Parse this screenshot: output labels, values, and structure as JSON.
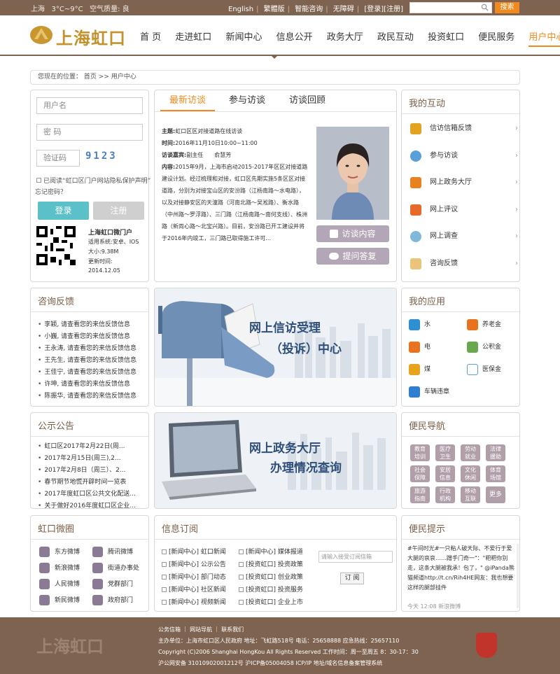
{
  "topbar": {
    "city": "上海",
    "temp": "3°C~9°C",
    "air": "空气质量: 良",
    "links": [
      "English",
      "繁體版",
      "智能咨询",
      "无障碍"
    ],
    "auth": "[登录][注册]",
    "search_button": "搜索"
  },
  "header": {
    "logo_text": "上海虹口",
    "nav": [
      "首 页",
      "走进虹口",
      "新闻中心",
      "信息公开",
      "政务大厅",
      "政民互动",
      "投资虹口",
      "便民服务",
      "用户中心"
    ],
    "active_nav": "用户中心"
  },
  "breadcrumb": {
    "label": "您现在的位置：",
    "home": "首页",
    "sep": ">>",
    "current": "用户中心"
  },
  "login": {
    "username_placeholder": "用户名",
    "password_placeholder": "密  码",
    "captcha_placeholder": "验证码",
    "captcha_code": "9123",
    "privacy": "已阅读“虹口区门户网站隐私保护声明”",
    "forgot": "忘记密码？",
    "login_button": "登录",
    "register_button": "注册",
    "app_title": "上海虹口微门户",
    "app_system": "适用系统:安卓、IOS",
    "app_size": "大小:9.38M",
    "app_updated_label": "更新时间:",
    "app_updated": "2014.12.05"
  },
  "interview": {
    "tabs": [
      "最新访谈",
      "参与访谈",
      "访谈回顾"
    ],
    "topic_label": "主题:",
    "topic": "虹口区区对接道路在线访谈",
    "time_label": "时间:",
    "time": "2016年11月10日10:00~11:00",
    "guest_label": "访谈嘉宾:",
    "guest": "副主任　　俞慧芳",
    "content_label": "内容:",
    "content": "2015年9月，上海市启动2015-2017年区区对接道路建设计划。经过梳理和对接，虹口区先期实施5条区区对接道路，分别为对接宝山区的安汾路（江杨南路～水电路），以及对接静安区的天潼路（河南北路～吴淞路）、衡水路（中州路～罗浮路）、三门路（江杨南路～南何支线）、株洲路（新両心路～北宝兴路）。目前，安汾路已开工建设并将于2016年内竣工，三门路已取得施工许可...",
    "btn_content": "访谈内容",
    "btn_question": "提问答复"
  },
  "my_interaction": {
    "title": "我的互动",
    "items": [
      "信访信箱反馈",
      "参与访谈",
      "网上政务大厅",
      "网上评议",
      "网上调查",
      "咨询反馈"
    ]
  },
  "consult": {
    "title": "咨询反馈",
    "items": [
      "李颖, 请查看您的来信反馈信息",
      "小巍, 请查看您的来信反馈信息",
      "王永涛, 请查看您的来信反馈信息",
      "王先生, 请查看您的来信反馈信息",
      "王佳宁, 请查看您的来信反馈信息",
      "许坤, 请查看您的来信反馈信息",
      "陈振华, 请查看您的来信反馈信息"
    ]
  },
  "banner1": {
    "line1": "网上信访受理",
    "line2": "（投诉）中心"
  },
  "my_apps": {
    "title": "我的应用",
    "items": [
      "水",
      "养老金",
      "电",
      "公积金",
      "煤",
      "医保金",
      "车辆违章"
    ]
  },
  "notice": {
    "title": "公示公告",
    "items": [
      "虹口区2017年2月22日(周...",
      "2017年2月15日(周三),2...",
      "2017年2月8日（周三）、2...",
      "春节期节地慌开辟时间一览表",
      "2017年度虹口区公共文化配送...",
      "关于做好2016年度虹口区企业..."
    ]
  },
  "banner2": {
    "line1": "网上政务大厅",
    "line2": "办理情况查询"
  },
  "convenience_nav": {
    "title": "便民导航",
    "items": [
      [
        "教育",
        "培训"
      ],
      [
        "医疗",
        "卫生"
      ],
      [
        "劳动",
        "就业"
      ],
      [
        "法律",
        "援助"
      ],
      [
        "社会",
        "保障"
      ],
      [
        "安居",
        "信息"
      ],
      [
        "文化",
        "休闲"
      ],
      [
        "体育",
        "场馆"
      ],
      [
        "旅游",
        "指南"
      ],
      [
        "行政",
        "机构"
      ],
      [
        "移动",
        "互联"
      ],
      [
        "更多",
        ""
      ]
    ]
  },
  "weibo": {
    "title": "虹口微圈",
    "items": [
      "东方微博",
      "腾讯微博",
      "新浪微博",
      "街道办事处",
      "人民微博",
      "党群部门",
      "新民微博",
      "政府部门"
    ]
  },
  "subscribe": {
    "title": "信息订阅",
    "items": [
      "[新闻中心] 虹口新闻",
      "[新闻中心] 媒体报道",
      "[新闻中心] 公示公告",
      "[投资虹口] 投资政策",
      "[新闻中心] 部门动态",
      "[投资虹口] 创业政策",
      "[新闻中心] 社区新闻",
      "[投资虹口] 投资服务",
      "[新闻中心] 视频新闻",
      "[投资虹口] 企业上市"
    ],
    "input_placeholder": "请输入接受订阅信箱",
    "button": "订 阅"
  },
  "tips": {
    "title": "便民提示",
    "text": "#午间时光#一只粘人破天际、不爱行于爱大腿的哀哀……蹭手门奇一\"：\"粑粑你别走，这条大腿被我承！包了，\" @iPanda熊猫频道http://t.cn/Rih4HE网友：我也想要这样的腿部挂件",
    "footer": "今天 12:08        新浪微博"
  },
  "footer": {
    "logo": "上海虹口",
    "links": "公务信箱 ｜ 网站导航 ｜ 联系我们",
    "line2": "主办单位：上海市虹口区人民政府 地址：飞虹路518号 电话：25658888 应急热线：25657110",
    "line3": "Copyright (C)2006 Shanghai HongKou All Rights Reserved 工作时间：周一至周五 8：30-17：30",
    "line4": "沪公网安备 31010902001212号 沪ICP备05004058    ICP/IP 地址/域名信息备案管理系统"
  },
  "colors": {
    "brand": "#7e6450",
    "accent": "#f08a1e",
    "teal": "#5bc0c8",
    "nav_btn": "#b09fa8"
  }
}
